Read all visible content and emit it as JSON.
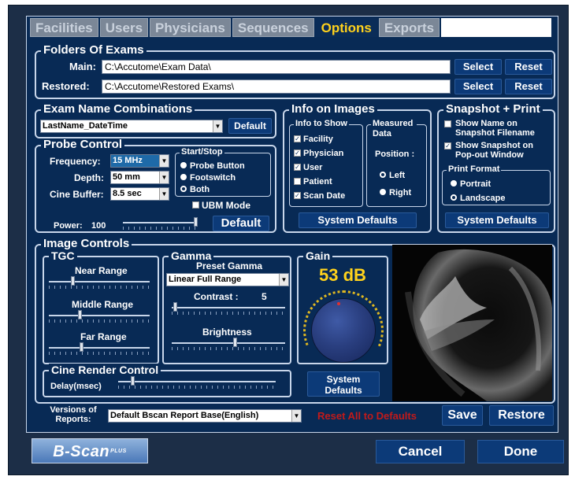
{
  "tabs": [
    "Facilities",
    "Users",
    "Physicians",
    "Sequences",
    "Options",
    "Exports"
  ],
  "active_tab": "Options",
  "folders": {
    "title": "Folders Of Exams",
    "main_label": "Main:",
    "main_value": "C:\\Accutome\\Exam Data\\",
    "restored_label": "Restored:",
    "restored_value": "C:\\Accutome\\Restored Exams\\",
    "select_label": "Select",
    "reset_label": "Reset"
  },
  "exam_name": {
    "title": "Exam Name Combinations",
    "value": "LastName_DateTime",
    "default_label": "Default"
  },
  "probe": {
    "title": "Probe Control",
    "frequency_label": "Frequency:",
    "frequency_value": "15 MHz",
    "depth_label": "Depth:",
    "depth_value": "50 mm",
    "cine_label": "Cine Buffer:",
    "cine_value": "8.5 sec",
    "startstop_title": "Start/Stop",
    "startstop_options": [
      "Probe Button",
      "Footswitch",
      "Both"
    ],
    "startstop_selected": 0,
    "ubm_label": "UBM Mode",
    "power_label": "Power:",
    "power_value": "100",
    "default_label": "Default"
  },
  "info_images": {
    "title": "Info on Images",
    "show_title": "Info to Show",
    "show_items": [
      "Facility",
      "Physician",
      "User",
      "Patient",
      "Scan Date"
    ],
    "measured_title": "Measured Data",
    "position_label": "Position :",
    "positions": [
      "Left",
      "Right"
    ],
    "position_selected": 1,
    "defaults_label": "System Defaults"
  },
  "snapshot": {
    "title": "Snapshot + Print",
    "opt1": "Show Name on Snapshot Filename",
    "opt2": "Show Snapshot on Pop-out Window",
    "print_title": "Print Format",
    "formats": [
      "Portrait",
      "Landscape"
    ],
    "format_selected": 0,
    "defaults_label": "System Defaults"
  },
  "image_controls": {
    "title": "Image Controls",
    "tgc_title": "TGC",
    "near_label": "Near Range",
    "middle_label": "Middle Range",
    "far_label": "Far Range",
    "gamma_title": "Gamma",
    "preset_label": "Preset Gamma",
    "preset_value": "Linear Full Range",
    "contrast_label": "Contrast :",
    "contrast_value": "5",
    "brightness_label": "Brightness",
    "gain_title": "Gain",
    "gain_value": "53 dB",
    "gain_defaults_label": "System Defaults"
  },
  "cine_render": {
    "title": "Cine Render Control",
    "delay_label": "Delay(msec)"
  },
  "reports": {
    "label": "Versions of Reports:",
    "value": "Default Bscan Report Base(English)",
    "reset_all_label": "Reset All to Defaults",
    "save_label": "Save",
    "restore_label": "Restore"
  },
  "footer": {
    "logo_text": "B-Scan",
    "logo_suffix": "PLUS",
    "cancel_label": "Cancel",
    "done_label": "Done"
  },
  "colors": {
    "background": "#082a55",
    "accent": "#ffd21c",
    "warning": "#c21a1a"
  }
}
